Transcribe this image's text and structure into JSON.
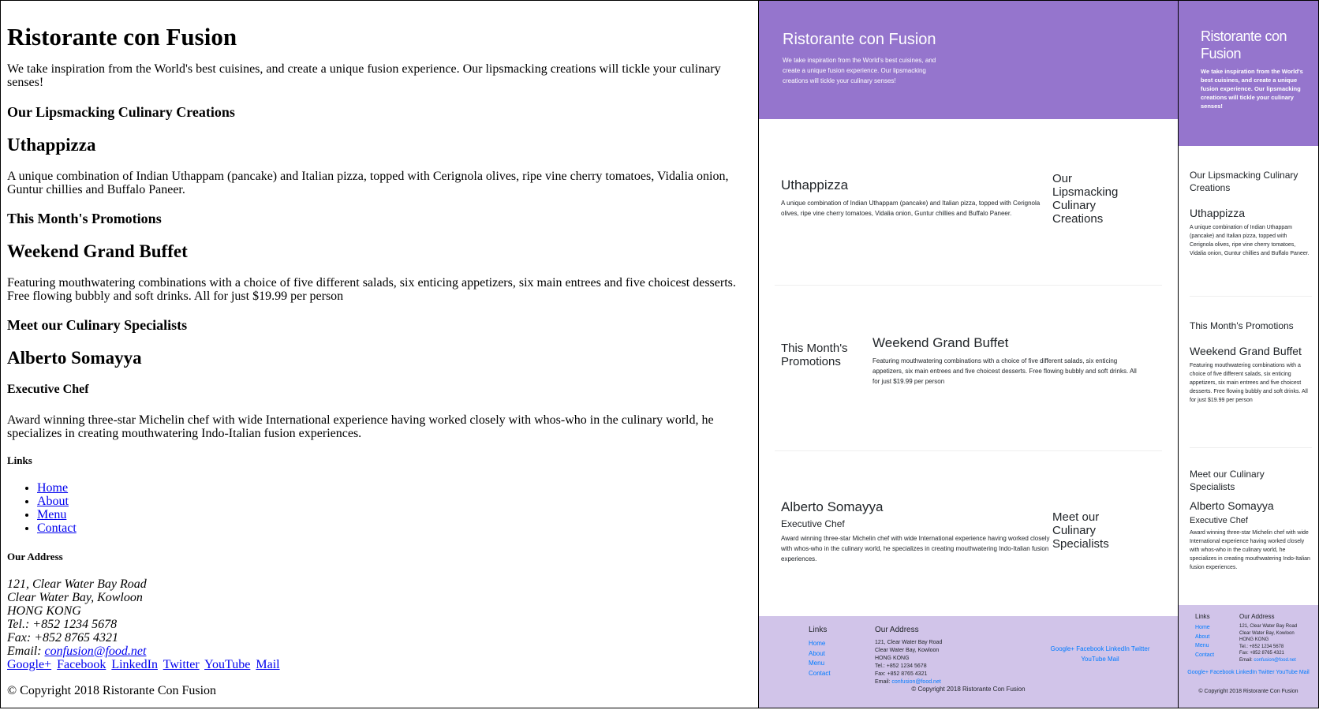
{
  "brand": {
    "title": "Ristorante con Fusion",
    "tagline": "We take inspiration from the World's best cuisines, and create a unique fusion experience. Our lipsmacking creations will tickle your culinary senses!"
  },
  "dish": {
    "section_heading": "Our Lipsmacking Culinary Creations",
    "name": "Uthappizza",
    "description": "A unique combination of Indian Uthappam (pancake) and Italian pizza, topped with Cerignola olives, ripe vine cherry tomatoes, Vidalia onion, Guntur chillies and Buffalo Paneer."
  },
  "promotion": {
    "section_heading": "This Month's Promotions",
    "name": "Weekend Grand Buffet",
    "description": "Featuring mouthwatering combinations with a choice of five different salads, six enticing appetizers, six main entrees and five choicest desserts. Free flowing bubbly and soft drinks. All for just $19.99 per person"
  },
  "leader": {
    "section_heading": "Meet our Culinary Specialists",
    "name": "Alberto Somayya",
    "designation": "Executive Chef",
    "description": "Award winning three-star Michelin chef with wide International experience having worked closely with whos-who in the culinary world, he specializes in creating mouthwatering Indo-Italian fusion experiences."
  },
  "footer": {
    "links_heading": "Links",
    "links": [
      "Home",
      "About",
      "Menu",
      "Contact"
    ],
    "address_heading": "Our Address",
    "address_lines": [
      "121, Clear Water Bay Road",
      "Clear Water Bay, Kowloon",
      "HONG KONG",
      "Tel.: +852 1234 5678",
      "Fax: +852 8765 4321"
    ],
    "email_label": "Email: ",
    "email": "confusion@food.net",
    "social": [
      "Google+",
      "Facebook",
      "LinkedIn",
      "Twitter",
      "YouTube",
      "Mail"
    ],
    "copyright": "© Copyright 2018 Ristorante Con Fusion"
  },
  "colors": {
    "jumbotron": "#9575cd",
    "footer_bg": "#d1c4e9",
    "link": "#007bff"
  }
}
